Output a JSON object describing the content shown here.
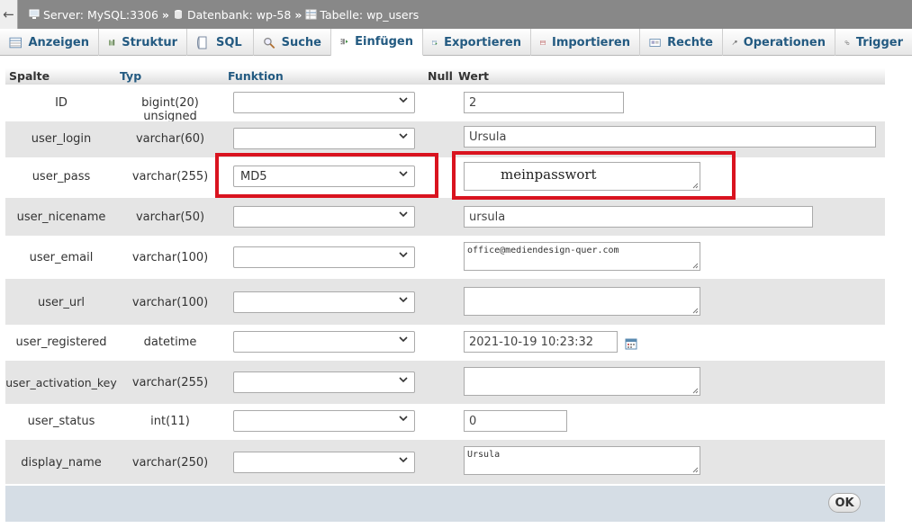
{
  "breadcrumb": {
    "back_label": "←",
    "server": "Server: MySQL:3306",
    "database": "Datenbank: wp-58",
    "table": "Tabelle: wp_users",
    "separator": "»"
  },
  "tabs": [
    {
      "label": "Anzeigen",
      "icon": "browse-icon",
      "active": false
    },
    {
      "label": "Struktur",
      "icon": "structure-icon",
      "active": false
    },
    {
      "label": "SQL",
      "icon": "sql-icon",
      "active": false
    },
    {
      "label": "Suche",
      "icon": "search-icon",
      "active": false
    },
    {
      "label": "Einfügen",
      "icon": "insert-icon",
      "active": true
    },
    {
      "label": "Exportieren",
      "icon": "export-icon",
      "active": false
    },
    {
      "label": "Importieren",
      "icon": "import-icon",
      "active": false
    },
    {
      "label": "Rechte",
      "icon": "privileges-icon",
      "active": false
    },
    {
      "label": "Operationen",
      "icon": "wrench-icon",
      "active": false
    },
    {
      "label": "Trigger",
      "icon": "trigger-icon",
      "active": false
    }
  ],
  "header": {
    "spalte": "Spalte",
    "typ": "Typ",
    "funktion": "Funktion",
    "null": "Null",
    "wert": "Wert"
  },
  "rows": [
    {
      "name": "ID",
      "type": "bigint(20) unsigned",
      "function": "",
      "value": "2"
    },
    {
      "name": "user_login",
      "type": "varchar(60)",
      "function": "",
      "value": "Ursula"
    },
    {
      "name": "user_pass",
      "type": "varchar(255)",
      "function": "MD5",
      "value": "meinpasswort"
    },
    {
      "name": "user_nicename",
      "type": "varchar(50)",
      "function": "",
      "value": "ursula"
    },
    {
      "name": "user_email",
      "type": "varchar(100)",
      "function": "",
      "value": "office@mediendesign-quer.com"
    },
    {
      "name": "user_url",
      "type": "varchar(100)",
      "function": "",
      "value": ""
    },
    {
      "name": "user_registered",
      "type": "datetime",
      "function": "",
      "value": "2021-10-19 10:23:32"
    },
    {
      "name": "user_activation_key",
      "type": "varchar(255)",
      "function": "",
      "value": ""
    },
    {
      "name": "user_status",
      "type": "int(11)",
      "function": "",
      "value": "0"
    },
    {
      "name": "display_name",
      "type": "varchar(250)",
      "function": "",
      "value": "Ursula"
    }
  ],
  "ok_label": "OK",
  "colors": {
    "highlight": "#d9131f",
    "link": "#235a81",
    "breadcrumb_bg": "#888888",
    "row_alt": "#e5e5e5",
    "footer_bg": "#d5dde5"
  }
}
